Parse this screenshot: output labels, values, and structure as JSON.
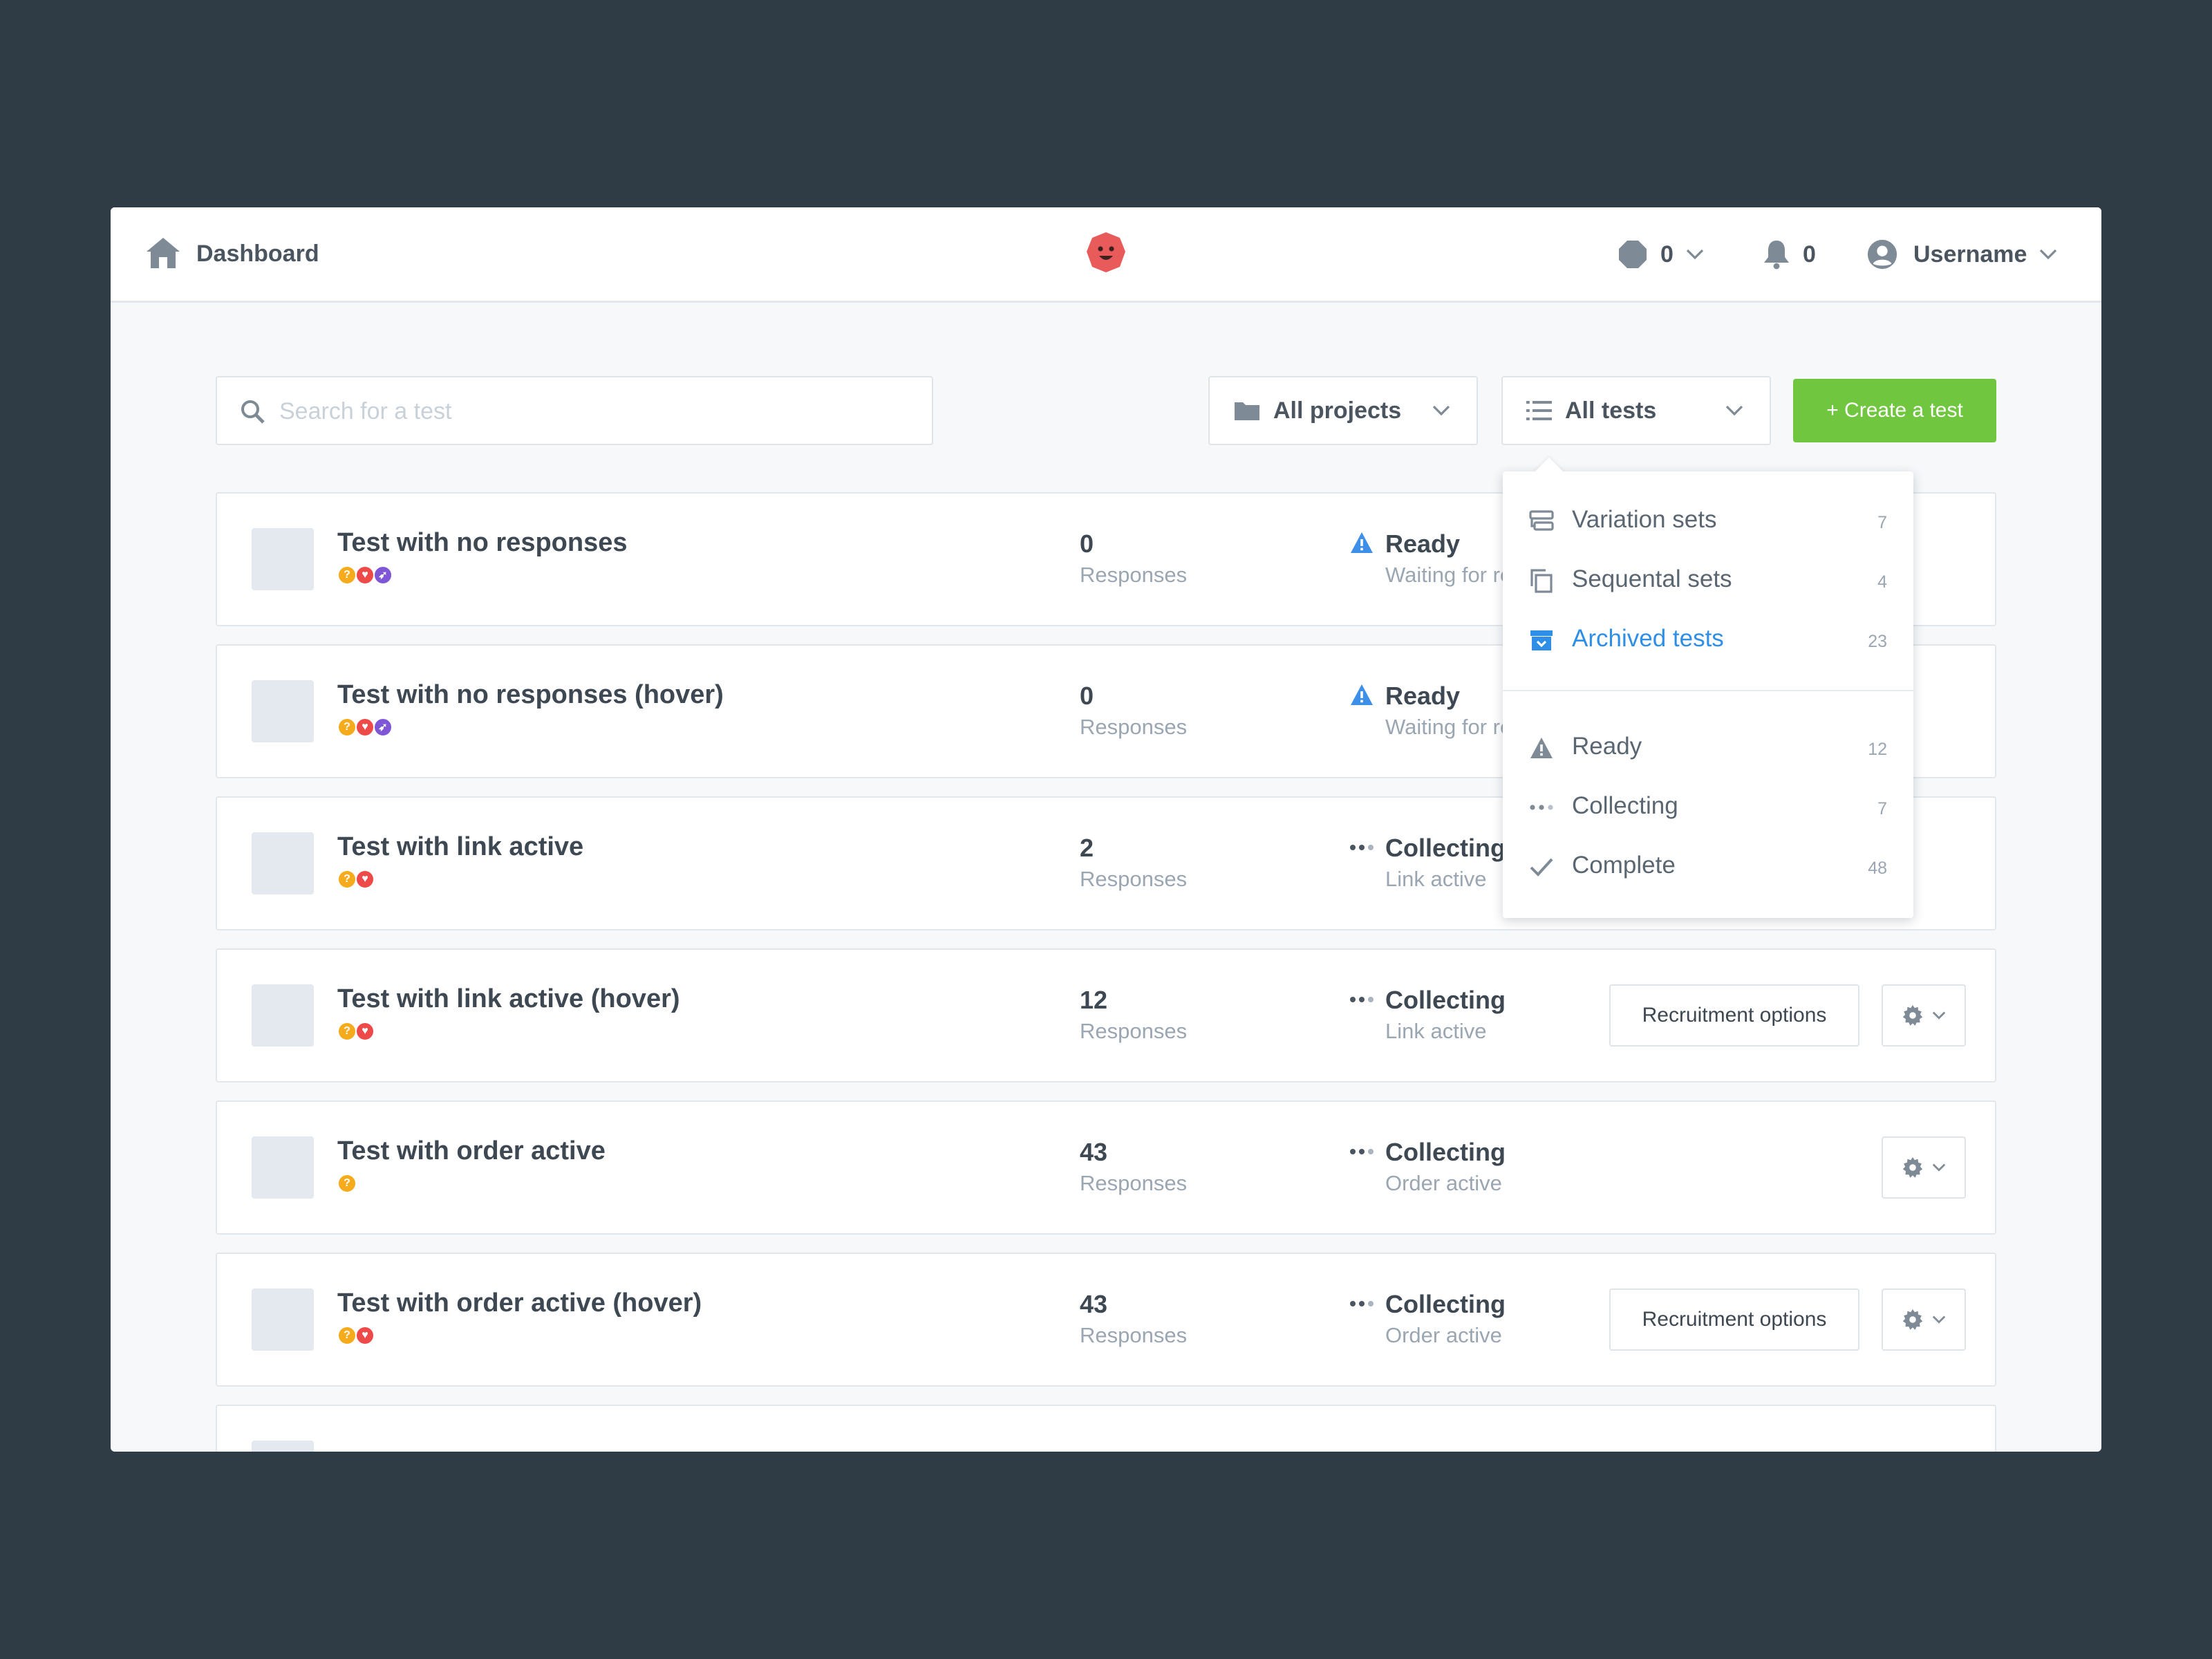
{
  "topbar": {
    "title": "Dashboard",
    "credits_count": "0",
    "notifications_count": "0",
    "username": "Username"
  },
  "search": {
    "placeholder": "Search for a test"
  },
  "filters": {
    "projects_label": "All projects",
    "tests_label": "All tests"
  },
  "create_button": "+ Create a test",
  "tests_menu": {
    "groups": [
      {
        "label": "Variation sets",
        "count": "7",
        "icon": "variation-sets-icon"
      },
      {
        "label": "Sequental sets",
        "count": "4",
        "icon": "sequential-sets-icon"
      },
      {
        "label": "Archived tests",
        "count": "23",
        "icon": "archive-icon",
        "active": true
      }
    ],
    "statuses": [
      {
        "label": "Ready",
        "count": "12",
        "icon": "warning-icon"
      },
      {
        "label": "Collecting",
        "count": "7",
        "icon": "dots-icon"
      },
      {
        "label": "Complete",
        "count": "48",
        "icon": "check-icon"
      }
    ]
  },
  "rows": [
    {
      "name": "Test with no responses",
      "responses": "0",
      "responses_label": "Responses",
      "status": "Ready",
      "status_sub": "Waiting for recruitment",
      "dots": [
        "question",
        "heart",
        "pointer"
      ]
    },
    {
      "name": "Test with no responses (hover)",
      "responses": "0",
      "responses_label": "Responses",
      "status": "Ready",
      "status_sub": "Waiting for recruitment",
      "dots": [
        "question",
        "heart",
        "pointer"
      ]
    },
    {
      "name": "Test with link active",
      "responses": "2",
      "responses_label": "Responses",
      "status": "Collecting",
      "status_sub": "Link active",
      "dots": [
        "question",
        "heart"
      ]
    },
    {
      "name": "Test with link active (hover)",
      "responses": "12",
      "responses_label": "Responses",
      "status": "Collecting",
      "status_sub": "Link active",
      "recruitment_button": "Recruitment options",
      "dots": [
        "question",
        "heart"
      ]
    },
    {
      "name": "Test with order active",
      "responses": "43",
      "responses_label": "Responses",
      "status": "Collecting",
      "status_sub": "Order active",
      "dots": [
        "question"
      ]
    },
    {
      "name": "Test with order active (hover)",
      "responses": "43",
      "responses_label": "Responses",
      "status": "Collecting",
      "status_sub": "Order active",
      "recruitment_button": "Recruitment options",
      "dots": [
        "question",
        "heart"
      ]
    }
  ],
  "colors": {
    "background": "#2f3b45",
    "accent_green": "#71c640",
    "accent_blue": "#2f8fe6",
    "warning_blue": "#3d8fe8"
  }
}
